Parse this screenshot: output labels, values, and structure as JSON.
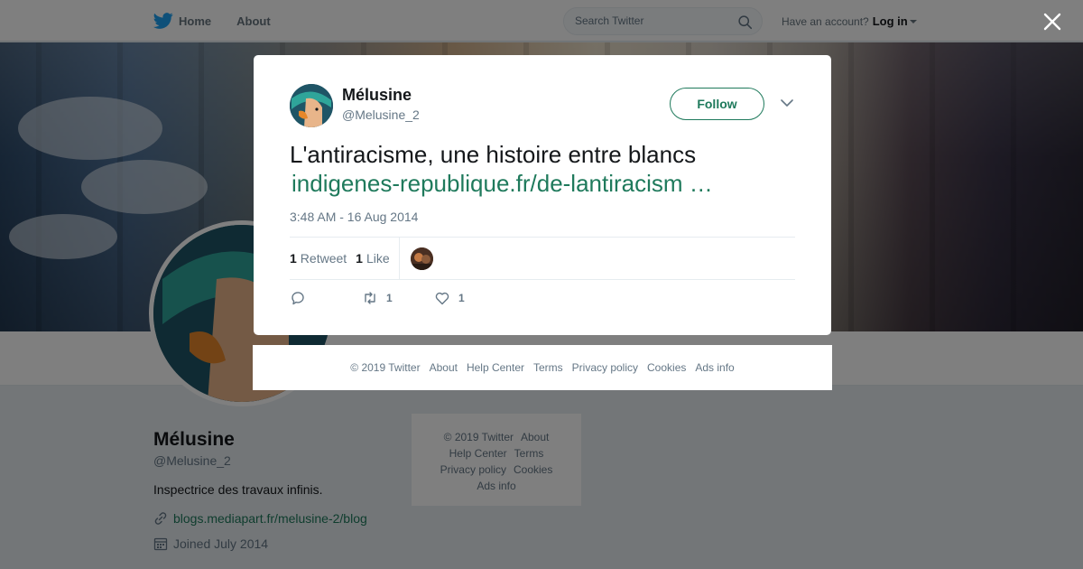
{
  "topbar": {
    "home_label": "Home",
    "about_label": "About",
    "search_placeholder": "Search Twitter",
    "account_prompt": "Have an account?",
    "login_label": "Log in"
  },
  "profile": {
    "name": "Mélusine",
    "handle": "@Melusine_2",
    "bio": "Inspectrice des travaux infinis.",
    "link": "blogs.mediapart.fr/melusine-2/blog",
    "joined": "Joined July 2014"
  },
  "side_footer": {
    "copyright": "© 2019 Twitter",
    "about": "About",
    "help": "Help Center",
    "terms": "Terms",
    "privacy": "Privacy policy",
    "cookies": "Cookies",
    "ads": "Ads info"
  },
  "tweet": {
    "author_name": "Mélusine",
    "author_handle": "@Melusine_2",
    "follow_label": "Follow",
    "text": "L'antiracisme, une histoire entre blancs",
    "link": "indigenes-republique.fr/de-lantiracism …",
    "timestamp": "3:48 AM - 16 Aug 2014",
    "retweet_count": "1",
    "retweet_label": "Retweet",
    "like_count": "1",
    "like_label": "Like",
    "action_retweet_count": "1",
    "action_like_count": "1"
  },
  "modal_footer": {
    "copyright": "© 2019 Twitter",
    "about": "About",
    "help": "Help Center",
    "terms": "Terms",
    "privacy": "Privacy policy",
    "cookies": "Cookies",
    "ads": "Ads info"
  },
  "colors": {
    "accent": "#1f7a5c",
    "twitter_blue": "#1da1f2",
    "text_secondary": "#657786"
  },
  "icons": [
    "twitter-bird-icon",
    "search-icon",
    "caret-down-icon",
    "close-icon",
    "chevron-down-icon",
    "reply-icon",
    "retweet-icon",
    "heart-icon",
    "link-icon",
    "calendar-icon"
  ]
}
